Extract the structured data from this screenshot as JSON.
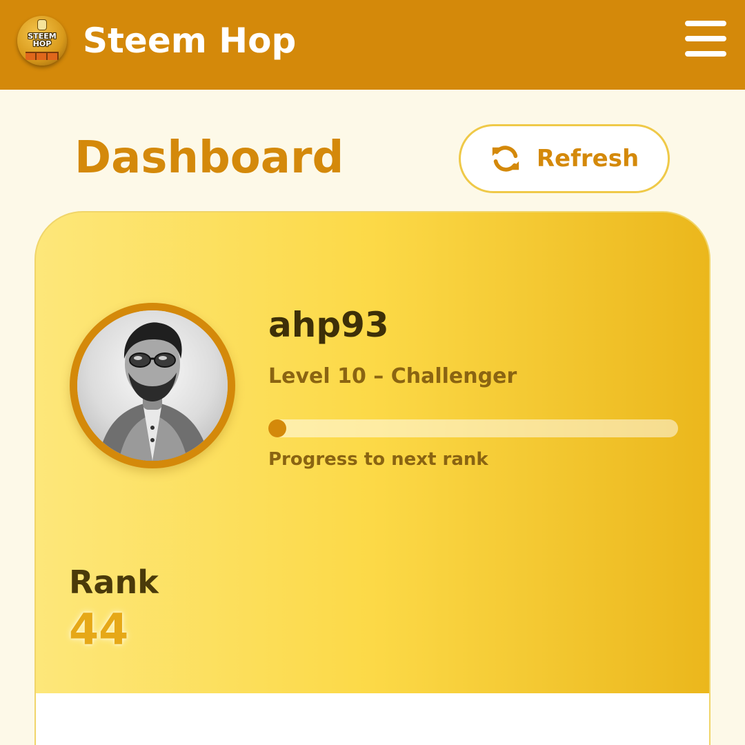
{
  "header": {
    "logo_text": "STEEM HOP",
    "app_title": "Steem Hop",
    "menu_icon": "hamburger-menu-icon"
  },
  "dashboard": {
    "title": "Dashboard",
    "refresh_label": "Refresh",
    "refresh_icon": "sync-arrows-icon"
  },
  "profile": {
    "username": "ahp93",
    "level_text": "Level 10 – Challenger",
    "progress_fraction": 0.02,
    "progress_caption": "Progress to next rank",
    "rank_label": "Rank",
    "rank_value": "44"
  },
  "colors": {
    "header_bg": "#d4890a",
    "accent": "#d4890a",
    "page_bg": "#fdf9e8",
    "card_gradient_start": "#fde77a",
    "card_gradient_end": "#ebb71c",
    "rank_value": "#e6a817"
  }
}
